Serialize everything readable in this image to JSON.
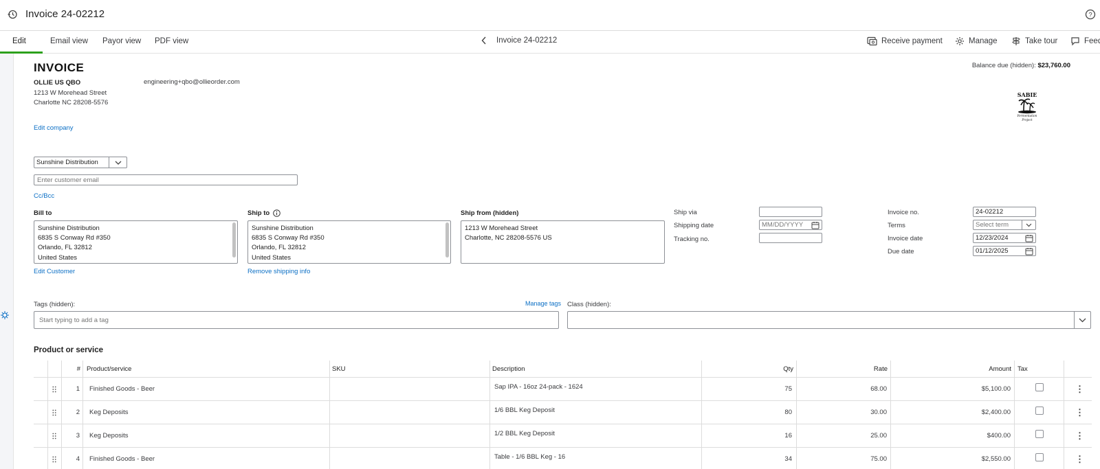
{
  "header": {
    "title": "Invoice 24-02212"
  },
  "tabs": [
    {
      "label": "Edit"
    },
    {
      "label": "Email view"
    },
    {
      "label": "Payor view"
    },
    {
      "label": "PDF view"
    }
  ],
  "center_nav": {
    "label": "Invoice 24-02212"
  },
  "actions": {
    "receive_payment": "Receive payment",
    "manage": "Manage",
    "take_tour": "Take tour",
    "feedback": "Feed"
  },
  "invoice": {
    "heading": "INVOICE",
    "balance_label": "Balance due (hidden):",
    "balance_value": "$23,760.00",
    "company": {
      "name": "OLLIE US QBO",
      "street": "1213 W Morehead Street",
      "city": "Charlotte NC 28208-5576",
      "email": "engineering+qbo@ollieorder.com",
      "edit_link": "Edit company"
    },
    "logo_text": {
      "top": "SABIE",
      "middle": "Fermentation",
      "bottom": "Project"
    },
    "customer": {
      "selected": "Sunshine Distribution",
      "email_placeholder": "Enter customer email",
      "ccbcc": "Cc/Bcc"
    },
    "bill_to": {
      "label": "Bill to",
      "lines": [
        "Sunshine Distribution",
        "6835 S Conway Rd #350",
        "Orlando, FL  32812",
        "United States"
      ],
      "link": "Edit Customer"
    },
    "ship_to": {
      "label": "Ship to",
      "lines": [
        "Sunshine Distribution",
        "6835 S Conway Rd #350",
        "Orlando, FL  32812",
        "United States"
      ],
      "link": "Remove shipping info"
    },
    "ship_from": {
      "label": "Ship from (hidden)",
      "lines": [
        "1213 W Morehead Street",
        "Charlotte, NC  28208-5576 US"
      ]
    },
    "shipping": {
      "ship_via_label": "Ship via",
      "ship_via_value": "",
      "shipping_date_label": "Shipping date",
      "shipping_date_placeholder": "MM/DD/YYYY",
      "tracking_label": "Tracking no.",
      "tracking_value": ""
    },
    "meta": {
      "invoice_no_label": "Invoice no.",
      "invoice_no_value": "24-02212",
      "terms_label": "Terms",
      "terms_placeholder": "Select term",
      "invoice_date_label": "Invoice date",
      "invoice_date_value": "12/23/2024",
      "due_date_label": "Due date",
      "due_date_value": "01/12/2025"
    },
    "tags": {
      "label": "Tags (hidden):",
      "manage": "Manage tags",
      "placeholder": "Start typing to add a tag"
    },
    "class": {
      "label": "Class (hidden):",
      "value": ""
    }
  },
  "products": {
    "title": "Product or service",
    "columns": {
      "num": "#",
      "product": "Product/service",
      "sku": "SKU",
      "description": "Description",
      "qty": "Qty",
      "rate": "Rate",
      "amount": "Amount",
      "tax": "Tax"
    },
    "rows": [
      {
        "num": "1",
        "product": "Finished Goods - Beer",
        "sku": "",
        "description": "Sap IPA - 16oz 24-pack - 1624",
        "qty": "75",
        "rate": "68.00",
        "amount": "$5,100.00",
        "tax": false
      },
      {
        "num": "2",
        "product": "Keg Deposits",
        "sku": "",
        "description": "1/6 BBL Keg Deposit",
        "qty": "80",
        "rate": "30.00",
        "amount": "$2,400.00",
        "tax": false
      },
      {
        "num": "3",
        "product": "Keg Deposits",
        "sku": "",
        "description": "1/2 BBL Keg Deposit",
        "qty": "16",
        "rate": "25.00",
        "amount": "$400.00",
        "tax": false
      },
      {
        "num": "4",
        "product": "Finished Goods - Beer",
        "sku": "",
        "description": "Table - 1/6 BBL Keg - 16",
        "qty": "34",
        "rate": "75.00",
        "amount": "$2,550.00",
        "tax": false
      }
    ]
  }
}
